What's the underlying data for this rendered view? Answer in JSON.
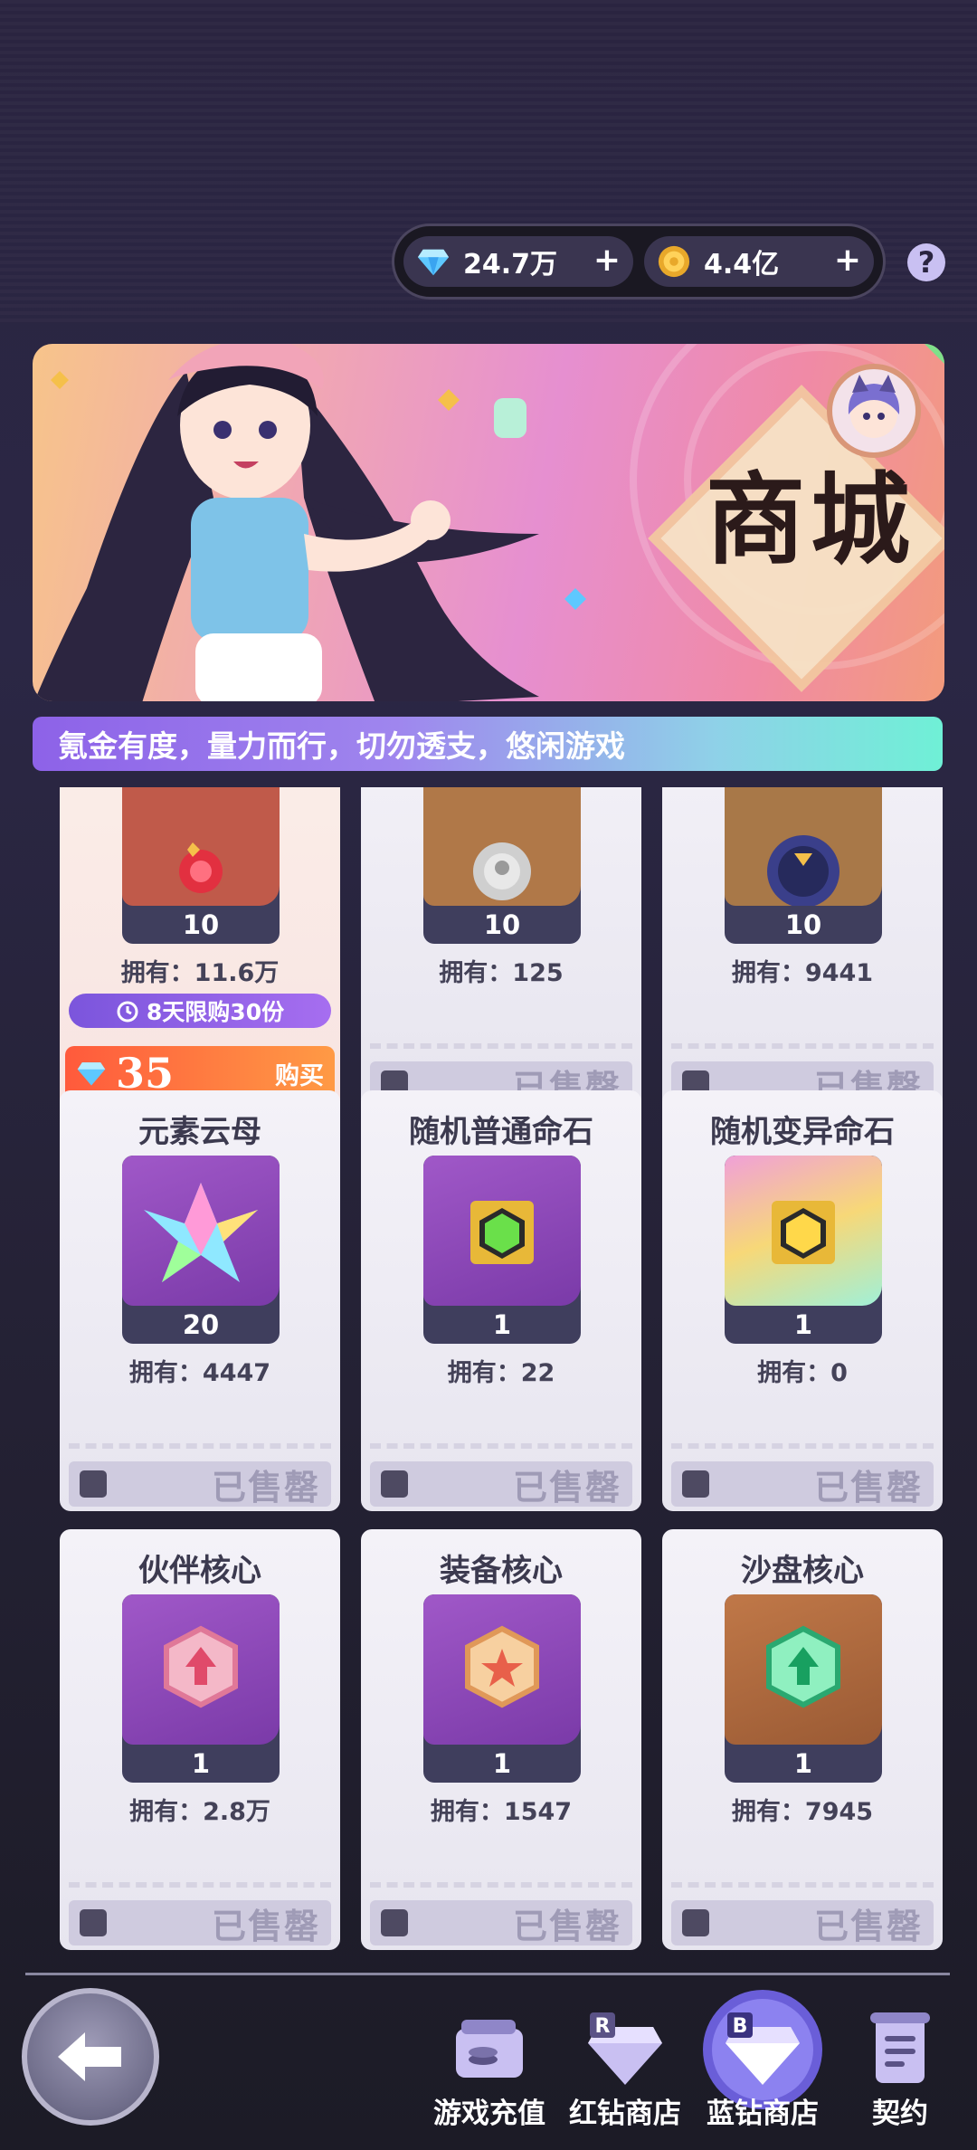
{
  "currency": {
    "diamond": "24.7万",
    "gold": "4.4亿",
    "plus": "+",
    "help": "?"
  },
  "banner": {
    "title": "商城"
  },
  "notice": "氪金有度，量力而行，切勿透支，悠闲游戏",
  "shop": {
    "sold_label": "已售罄",
    "items": [
      {
        "name": "",
        "qty": "10",
        "own": "拥有：11.6万",
        "limit": "8天限购30份",
        "price": "35",
        "buy": "购买",
        "art": "#c05a4a",
        "status": "buy"
      },
      {
        "name": "",
        "qty": "10",
        "own": "拥有：125",
        "art": "#b07848",
        "status": "sold"
      },
      {
        "name": "",
        "qty": "10",
        "own": "拥有：9441",
        "art": "#a87848",
        "status": "sold"
      },
      {
        "name": "元素云母",
        "qty": "20",
        "own": "拥有：4447",
        "art": "#8b4bb0",
        "status": "sold"
      },
      {
        "name": "随机普通命石",
        "qty": "1",
        "own": "拥有：22",
        "art": "#8b4bb0",
        "status": "sold"
      },
      {
        "name": "随机变异命石",
        "qty": "1",
        "own": "拥有：0",
        "art": "#e6a0d0",
        "status": "sold"
      },
      {
        "name": "伙伴核心",
        "qty": "1",
        "own": "拥有：2.8万",
        "art": "#8b4bb0",
        "status": "sold"
      },
      {
        "name": "装备核心",
        "qty": "1",
        "own": "拥有：1547",
        "art": "#8b4bb0",
        "status": "sold"
      },
      {
        "name": "沙盘核心",
        "qty": "1",
        "own": "拥有：7945",
        "art": "#b0683c",
        "status": "sold"
      }
    ]
  },
  "nav": {
    "recharge": "游戏充值",
    "red_shop": "红钻商店",
    "blue_shop": "蓝钻商店",
    "contract": "契约",
    "red_letter": "R",
    "blue_letter": "B"
  }
}
